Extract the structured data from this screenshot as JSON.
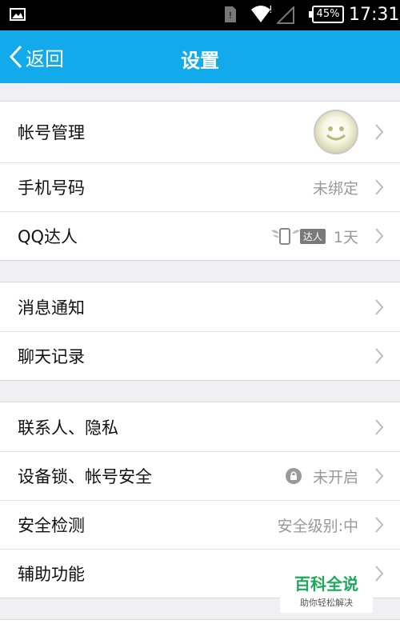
{
  "status_bar": {
    "battery": "45%",
    "time": "17:31"
  },
  "nav": {
    "back_label": "返回",
    "title": "设置"
  },
  "groups": [
    {
      "items": [
        {
          "label": "帐号管理",
          "value": ""
        },
        {
          "label": "手机号码",
          "value": "未绑定"
        },
        {
          "label": "QQ达人",
          "badge": "达人",
          "value": "1天"
        }
      ]
    },
    {
      "items": [
        {
          "label": "消息通知",
          "value": ""
        },
        {
          "label": "聊天记录",
          "value": ""
        }
      ]
    },
    {
      "items": [
        {
          "label": "联系人、隐私",
          "value": ""
        },
        {
          "label": "设备锁、帐号安全",
          "value": "未开启"
        },
        {
          "label": "安全检测",
          "value": "安全级别:中"
        },
        {
          "label": "辅助功能",
          "value": ""
        }
      ]
    }
  ],
  "watermark": {
    "title": "百科全说",
    "subtitle": "助你轻松解决"
  },
  "colors": {
    "nav_bg": "#12aaeb",
    "status_bg": "#000000",
    "page_bg": "#efeff4",
    "watermark_green": "#1aab5a"
  }
}
